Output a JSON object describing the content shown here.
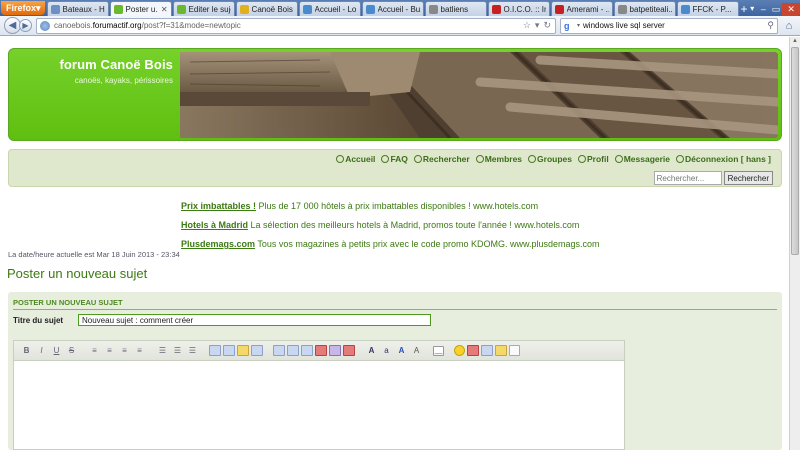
{
  "browser": {
    "firefox_label": "Firefox",
    "tabs": [
      {
        "label": "Bateaux - H...",
        "color": "#6e8fc6",
        "active": false
      },
      {
        "label": "Poster u...",
        "color": "#6ab82b",
        "active": true
      },
      {
        "label": "Editer le sujet",
        "color": "#6ab82b",
        "active": false
      },
      {
        "label": "Canoë Bois ...",
        "color": "#e0b020",
        "active": false
      },
      {
        "label": "Accueil - Lo...",
        "color": "#4a8bd0",
        "active": false
      },
      {
        "label": "Accueil - Bu...",
        "color": "#4a8bd0",
        "active": false
      },
      {
        "label": "batliens",
        "color": "#888888",
        "active": false
      },
      {
        "label": "O.I.C.O. :: In...",
        "color": "#c82020",
        "active": false
      },
      {
        "label": "Amerami - ...",
        "color": "#c82020",
        "active": false
      },
      {
        "label": "batpetiteali...",
        "color": "#888888",
        "active": false
      },
      {
        "label": "FFCK - P...",
        "color": "#4a8bd0",
        "active": false
      }
    ],
    "url_prefix": "canoebois.",
    "url_domain": "forumactif.org",
    "url_path": "/post?f=31&mode=newtopic",
    "search_value": "windows live sql server"
  },
  "forum": {
    "title": "forum Canoë Bois",
    "subtitle": "canoës, kayaks, périssoires",
    "menu": [
      {
        "label": "Accueil"
      },
      {
        "label": "FAQ"
      },
      {
        "label": "Rechercher"
      },
      {
        "label": "Membres"
      },
      {
        "label": "Groupes"
      },
      {
        "label": "Profil"
      },
      {
        "label": "Messagerie"
      },
      {
        "label": "Déconnexion [ hans ]"
      }
    ],
    "search_placeholder": "Rechercher...",
    "search_button": "Rechercher"
  },
  "ads": [
    {
      "title": "Prix imbattables !",
      "text": " Plus de 17 000 hôtels à prix imbattables disponibles ! www.hotels.com"
    },
    {
      "title": "Hotels à Madrid",
      "text": " La sélection des meilleurs hotels à Madrid, promos toute l'année ! www.hotels.com"
    },
    {
      "title": "Plusdemags.com",
      "text": " Tous vos magazines à petits prix avec le code promo KDOMG. www.plusdemags.com"
    }
  ],
  "datetime": "La date/heure actuelle est Mar 18 Juin 2013 - 23:34",
  "page_title": "Poster un nouveau sujet",
  "post": {
    "section_header": "POSTER UN NOUVEAU SUJET",
    "subject_label": "Titre du sujet",
    "subject_value": "Nouveau sujet : comment créer"
  }
}
